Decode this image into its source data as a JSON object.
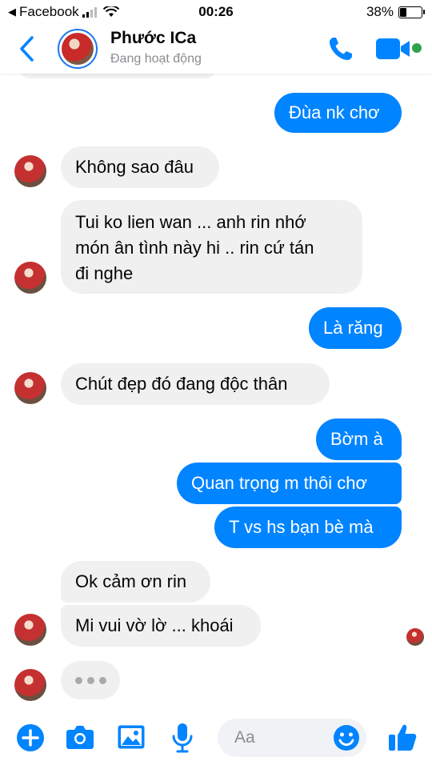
{
  "status_bar": {
    "back_app": "Facebook",
    "time": "00:26",
    "battery": "38%"
  },
  "header": {
    "name": "Phước ICa",
    "status": "Đang hoạt động"
  },
  "messages": [
    {
      "side": "out",
      "text": "Đùa nk chơ"
    },
    {
      "side": "in",
      "text": "Không sao đâu"
    },
    {
      "side": "in",
      "line1": "Tui ko lien wan ... anh rin nhớ",
      "line2": "món ân tình này hi ..  rin cứ tán",
      "line3": "đi nghe"
    },
    {
      "side": "out",
      "text": "Là răng"
    },
    {
      "side": "in",
      "text": "Chút đẹp đó đang độc thân"
    },
    {
      "side": "out",
      "text": "Bờm à"
    },
    {
      "side": "out",
      "text": "Quan trọng m thôi chơ"
    },
    {
      "side": "out",
      "text": "T vs hs bạn bè mà"
    },
    {
      "side": "in",
      "text": "Ok cảm ơn rin"
    },
    {
      "side": "in",
      "text": "Mi vui vờ lờ ... khoái"
    }
  ],
  "composer": {
    "placeholder": "Aa"
  },
  "colors": {
    "accent": "#0084ff",
    "incoming_bubble": "#f0f0f0",
    "online": "#31a24c"
  },
  "icons": [
    "back-chevron-icon",
    "phone-icon",
    "video-icon",
    "plus-icon",
    "camera-icon",
    "image-icon",
    "microphone-icon",
    "emoji-icon",
    "like-icon"
  ]
}
